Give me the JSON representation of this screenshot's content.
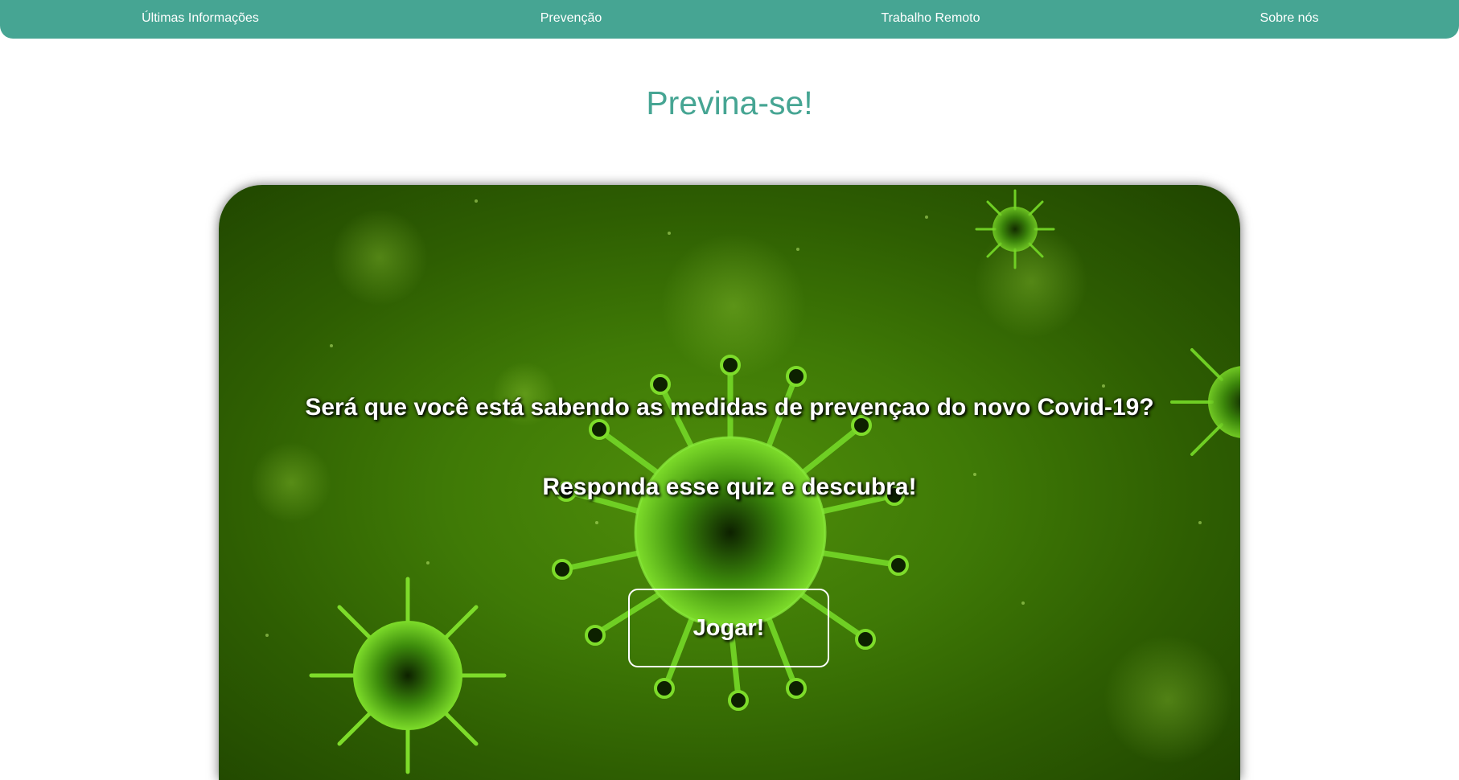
{
  "nav": {
    "items": [
      {
        "label": "Últimas Informações"
      },
      {
        "label": "Prevenção"
      },
      {
        "label": "Trabalho Remoto"
      },
      {
        "label": "Sobre nós"
      }
    ]
  },
  "page": {
    "title": "Previna-se!"
  },
  "hero": {
    "question": "Será que você está sabendo as medidas de prevençao do novo Covid-19?",
    "call_to_action": "Responda esse quiz e descubra!",
    "button_label": "Jogar!",
    "background_icon": "coronavirus-icon"
  },
  "colors": {
    "accent": "#46a593",
    "hero_green": "#3f7a06",
    "virus_green": "#7ddc2a"
  }
}
